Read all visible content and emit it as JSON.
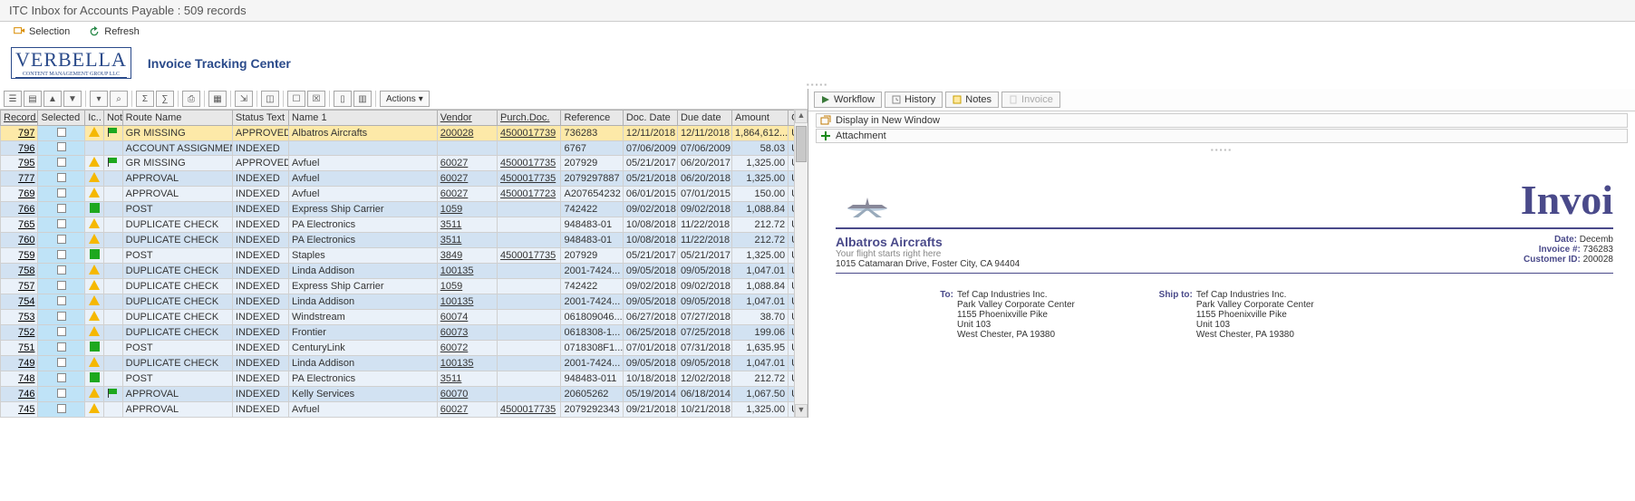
{
  "window": {
    "title": "ITC Inbox for Accounts Payable : 509 records"
  },
  "toolbar": {
    "selection_label": "Selection",
    "refresh_label": "Refresh"
  },
  "brand": {
    "logo_text": "VERBELLA",
    "subtitle": "Invoice Tracking Center"
  },
  "actions_label": "Actions",
  "columns": {
    "record": "Record ...",
    "selected": "Selected",
    "ic": "Ic..",
    "not": "Not",
    "route": "Route Name",
    "status": "Status Text",
    "name": "Name 1",
    "vendor": "Vendor",
    "purch": "Purch.Doc.",
    "ref": "Reference",
    "docdate": "Doc. Date",
    "duedate": "Due date",
    "amount": "Amount",
    "cur": "Cur"
  },
  "rows": [
    {
      "rec": "797",
      "icon": "tri",
      "flag": true,
      "route": "GR MISSING",
      "status": "APPROVED",
      "name": "Albatros Aircrafts",
      "vendor": "200028",
      "purch": "4500017739",
      "ref": "736283",
      "docdate": "12/11/2018",
      "duedate": "12/11/2018",
      "amount": "1,864,612...",
      "cur": "US",
      "sel": true
    },
    {
      "rec": "796",
      "icon": "",
      "flag": false,
      "route": "ACCOUNT ASSIGNMENT",
      "status": "INDEXED",
      "name": "",
      "vendor": "",
      "purch": "",
      "ref": "6767",
      "docdate": "07/06/2009",
      "duedate": "07/06/2009",
      "amount": "58.03",
      "cur": "US"
    },
    {
      "rec": "795",
      "icon": "tri",
      "flag": true,
      "route": "GR MISSING",
      "status": "APPROVED",
      "name": "Avfuel",
      "vendor": "60027",
      "purch": "4500017735",
      "ref": "207929",
      "docdate": "05/21/2017",
      "duedate": "06/20/2017",
      "amount": "1,325.00",
      "cur": "US"
    },
    {
      "rec": "777",
      "icon": "tri",
      "flag": false,
      "route": "APPROVAL",
      "status": "INDEXED",
      "name": "Avfuel",
      "vendor": "60027",
      "purch": "4500017735",
      "ref": "2079297887",
      "docdate": "05/21/2018",
      "duedate": "06/20/2018",
      "amount": "1,325.00",
      "cur": "US"
    },
    {
      "rec": "769",
      "icon": "tri",
      "flag": false,
      "route": "APPROVAL",
      "status": "INDEXED",
      "name": "Avfuel",
      "vendor": "60027",
      "purch": "4500017723",
      "ref": "A207654232",
      "docdate": "06/01/2015",
      "duedate": "07/01/2015",
      "amount": "150.00",
      "cur": "US"
    },
    {
      "rec": "766",
      "icon": "sq",
      "flag": false,
      "route": "POST",
      "status": "INDEXED",
      "name": "Express Ship Carrier",
      "vendor": "1059",
      "purch": "",
      "ref": "742422",
      "docdate": "09/02/2018",
      "duedate": "09/02/2018",
      "amount": "1,088.84",
      "cur": "US"
    },
    {
      "rec": "765",
      "icon": "tri",
      "flag": false,
      "route": "DUPLICATE CHECK",
      "status": "INDEXED",
      "name": "PA Electronics",
      "vendor": "3511",
      "purch": "",
      "ref": "948483-01",
      "docdate": "10/08/2018",
      "duedate": "11/22/2018",
      "amount": "212.72",
      "cur": "US"
    },
    {
      "rec": "760",
      "icon": "tri",
      "flag": false,
      "route": "DUPLICATE CHECK",
      "status": "INDEXED",
      "name": "PA Electronics",
      "vendor": "3511",
      "purch": "",
      "ref": "948483-01",
      "docdate": "10/08/2018",
      "duedate": "11/22/2018",
      "amount": "212.72",
      "cur": "US"
    },
    {
      "rec": "759",
      "icon": "sq",
      "flag": false,
      "route": "POST",
      "status": "INDEXED",
      "name": "Staples",
      "vendor": "3849",
      "purch": "4500017735",
      "ref": "207929",
      "docdate": "05/21/2017",
      "duedate": "05/21/2017",
      "amount": "1,325.00",
      "cur": "US"
    },
    {
      "rec": "758",
      "icon": "tri",
      "flag": false,
      "route": "DUPLICATE CHECK",
      "status": "INDEXED",
      "name": "Linda Addison",
      "vendor": "100135",
      "purch": "",
      "ref": "2001-7424...",
      "docdate": "09/05/2018",
      "duedate": "09/05/2018",
      "amount": "1,047.01",
      "cur": "US"
    },
    {
      "rec": "757",
      "icon": "tri",
      "flag": false,
      "route": "DUPLICATE CHECK",
      "status": "INDEXED",
      "name": "Express Ship Carrier",
      "vendor": "1059",
      "purch": "",
      "ref": "742422",
      "docdate": "09/02/2018",
      "duedate": "09/02/2018",
      "amount": "1,088.84",
      "cur": "US"
    },
    {
      "rec": "754",
      "icon": "tri",
      "flag": false,
      "route": "DUPLICATE CHECK",
      "status": "INDEXED",
      "name": "Linda Addison",
      "vendor": "100135",
      "purch": "",
      "ref": "2001-7424...",
      "docdate": "09/05/2018",
      "duedate": "09/05/2018",
      "amount": "1,047.01",
      "cur": "US"
    },
    {
      "rec": "753",
      "icon": "tri",
      "flag": false,
      "route": "DUPLICATE CHECK",
      "status": "INDEXED",
      "name": "Windstream",
      "vendor": "60074",
      "purch": "",
      "ref": "061809046...",
      "docdate": "06/27/2018",
      "duedate": "07/27/2018",
      "amount": "38.70",
      "cur": "US"
    },
    {
      "rec": "752",
      "icon": "tri",
      "flag": false,
      "route": "DUPLICATE CHECK",
      "status": "INDEXED",
      "name": "Frontier",
      "vendor": "60073",
      "purch": "",
      "ref": "0618308-1...",
      "docdate": "06/25/2018",
      "duedate": "07/25/2018",
      "amount": "199.06",
      "cur": "US"
    },
    {
      "rec": "751",
      "icon": "sq",
      "flag": false,
      "route": "POST",
      "status": "INDEXED",
      "name": "CenturyLink",
      "vendor": "60072",
      "purch": "",
      "ref": "0718308F1...",
      "docdate": "07/01/2018",
      "duedate": "07/31/2018",
      "amount": "1,635.95",
      "cur": "US"
    },
    {
      "rec": "749",
      "icon": "tri",
      "flag": false,
      "route": "DUPLICATE CHECK",
      "status": "INDEXED",
      "name": "Linda Addison",
      "vendor": "100135",
      "purch": "",
      "ref": "2001-7424...",
      "docdate": "09/05/2018",
      "duedate": "09/05/2018",
      "amount": "1,047.01",
      "cur": "US"
    },
    {
      "rec": "748",
      "icon": "sq",
      "flag": false,
      "route": "POST",
      "status": "INDEXED",
      "name": "PA Electronics",
      "vendor": "3511",
      "purch": "",
      "ref": "948483-011",
      "docdate": "10/18/2018",
      "duedate": "12/02/2018",
      "amount": "212.72",
      "cur": "US"
    },
    {
      "rec": "746",
      "icon": "tri",
      "flag": true,
      "route": "APPROVAL",
      "status": "INDEXED",
      "name": "Kelly Services",
      "vendor": "60070",
      "purch": "",
      "ref": "20605262",
      "docdate": "05/19/2014",
      "duedate": "06/18/2014",
      "amount": "1,067.50",
      "cur": "US"
    },
    {
      "rec": "745",
      "icon": "tri",
      "flag": false,
      "route": "APPROVAL",
      "status": "INDEXED",
      "name": "Avfuel",
      "vendor": "60027",
      "purch": "4500017735",
      "ref": "2079292343",
      "docdate": "09/21/2018",
      "duedate": "10/21/2018",
      "amount": "1,325.00",
      "cur": "US"
    }
  ],
  "right": {
    "tabs": {
      "workflow": "Workflow",
      "history": "History",
      "notes": "Notes",
      "invoice": "Invoice"
    },
    "link_display": "Display in New Window",
    "link_attach": "Attachment"
  },
  "invoice": {
    "title_fragment": "Invoi",
    "company": "Albatros Aircrafts",
    "tagline": "Your flight starts right here",
    "address": "1015 Catamaran Drive, Foster City, CA 94404",
    "date_label": "Date:",
    "date_val": "Decemb",
    "invno_label": "Invoice #:",
    "invno_val": "736283",
    "cust_label": "Customer ID:",
    "cust_val": "200028",
    "to_label": "To:",
    "shipto_label": "Ship to:",
    "to_lines": [
      "Tef Cap Industries Inc.",
      "Park Valley Corporate Center",
      "1155 Phoenixville Pike",
      "Unit 103",
      "West Chester, PA 19380"
    ],
    "ship_lines": [
      "Tef Cap Industries Inc.",
      "Park Valley Corporate Center",
      "1155 Phoenixville Pike",
      "Unit 103",
      "West Chester, PA 19380"
    ]
  }
}
